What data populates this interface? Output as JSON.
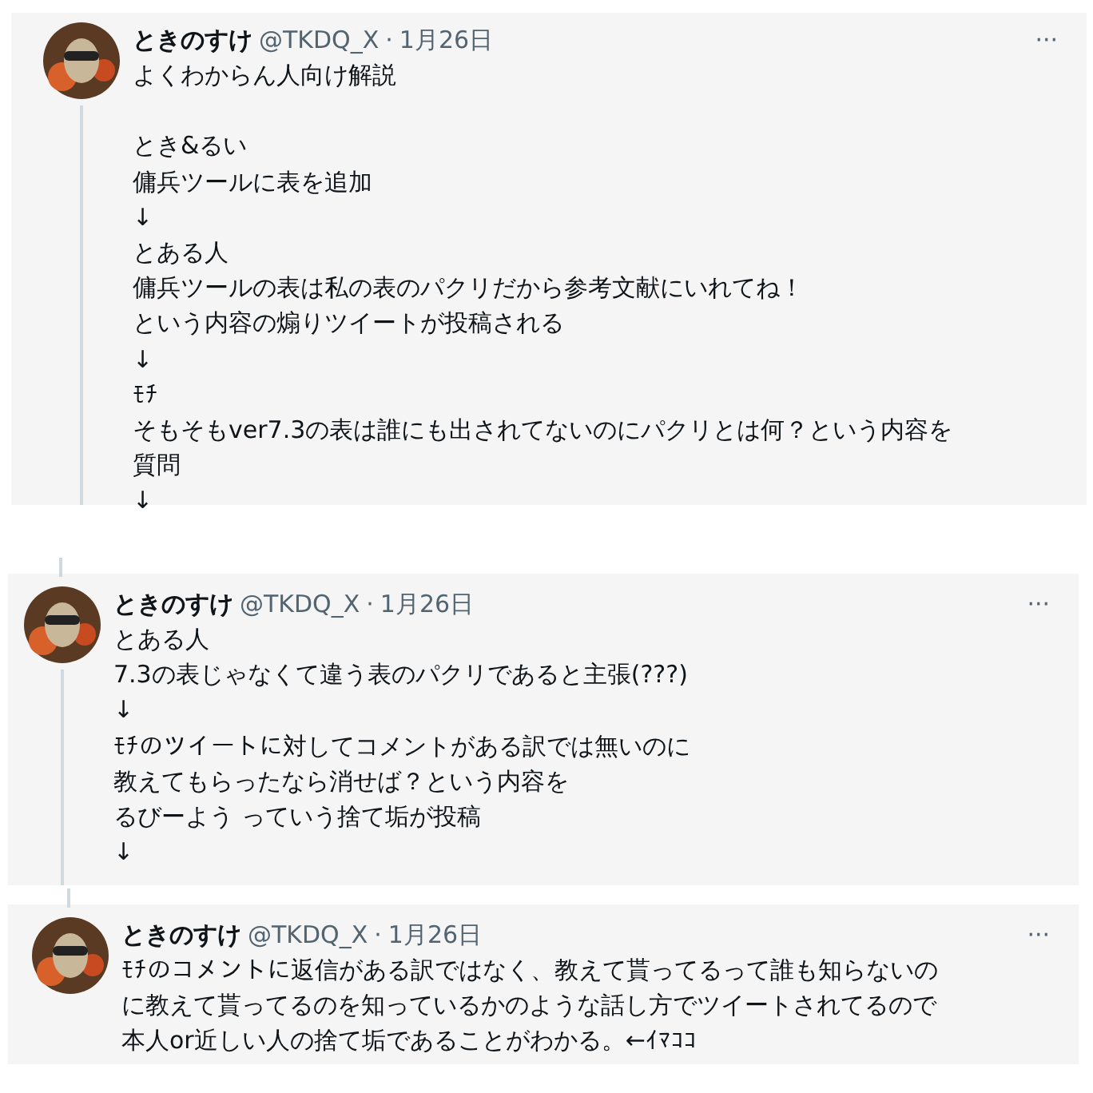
{
  "tweets": [
    {
      "name": "ときのすけ",
      "handle": "@TKDQ_X",
      "separator": "·",
      "date": "1月26日",
      "more": "···",
      "thread_above": false,
      "thread_below": true,
      "paragraphs": [
        [
          "よくわからん人向け解説"
        ],
        [
          "とき&るい",
          "傭兵ツールに表を追加",
          "↓",
          "とある人",
          "傭兵ツールの表は私の表のパクリだから参考文献にいれてね！",
          "という内容の煽りツイートが投稿される",
          "↓",
          "ﾓﾁ",
          "そもそもver7.3の表は誰にも出されてないのにパクリとは何？という内容を",
          "質問",
          "↓"
        ]
      ]
    },
    {
      "name": "ときのすけ",
      "handle": "@TKDQ_X",
      "separator": "·",
      "date": "1月26日",
      "more": "···",
      "thread_above": true,
      "thread_below": true,
      "paragraphs": [
        [
          "とある人",
          "7.3の表じゃなくて違う表のパクリであると主張(???)",
          "↓",
          "ﾓﾁのツイートに対してコメントがある訳では無いのに",
          "教えてもらったなら消せば？という内容を",
          "るびーよう っていう捨て垢が投稿",
          "↓"
        ]
      ]
    },
    {
      "name": "ときのすけ",
      "handle": "@TKDQ_X",
      "separator": "·",
      "date": "1月26日",
      "more": "···",
      "thread_above": true,
      "thread_below": false,
      "paragraphs": [
        [
          "ﾓﾁのコメントに返信がある訳ではなく、教えて貰ってるって誰も知らないの",
          "に教えて貰ってるのを知っているかのような話し方でツイートされてるので",
          "本人or近しい人の捨て垢であることがわかる。←ｲﾏｺｺ"
        ]
      ]
    }
  ]
}
